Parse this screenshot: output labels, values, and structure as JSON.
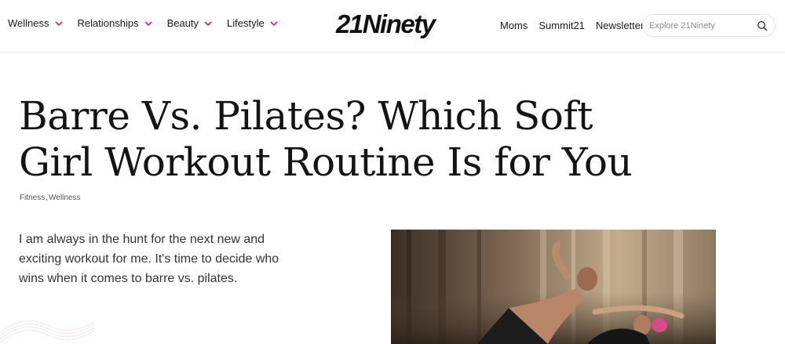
{
  "header": {
    "nav_left": [
      {
        "label": "Wellness"
      },
      {
        "label": "Relationships"
      },
      {
        "label": "Beauty"
      },
      {
        "label": "Lifestyle"
      }
    ],
    "logo": "21Ninety",
    "nav_right": [
      {
        "label": "Moms"
      },
      {
        "label": "Summit21"
      },
      {
        "label": "Newsletter"
      }
    ],
    "search": {
      "placeholder": "Explore 21Ninety",
      "icon": "search-icon"
    },
    "chevron_color": "#e0196b"
  },
  "article": {
    "title": "Barre Vs. Pilates? Which Soft Girl Workout Routine Is for You",
    "categories": [
      "Fitness",
      "Wellness"
    ],
    "category_separator": ",",
    "intro": "I am always in the hunt for the next new and exciting workout for me. It's time to decide who wins when it comes to barre vs. pilates."
  }
}
